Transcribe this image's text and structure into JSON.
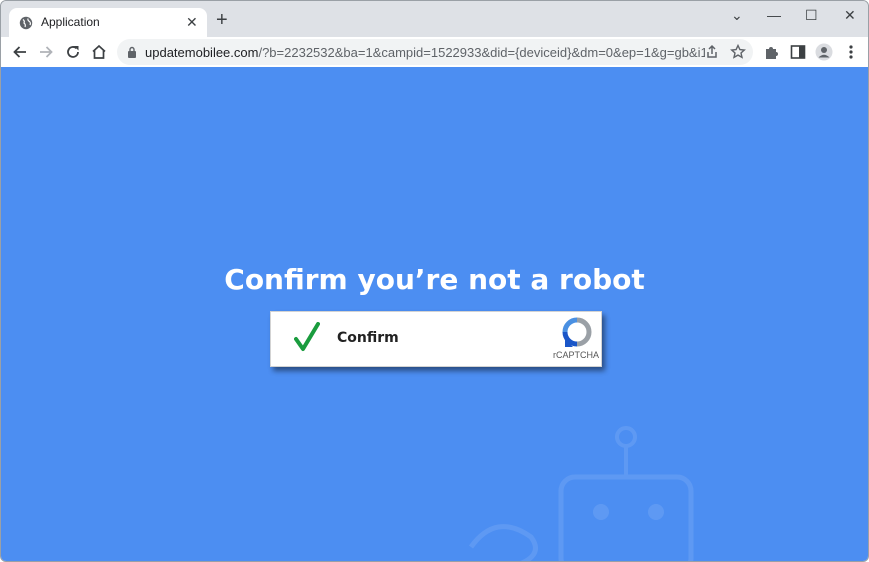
{
  "browser": {
    "tab_title": "Application",
    "tab_close": "✕",
    "new_tab": "+",
    "url_host": "updatemobilee.com",
    "url_rest": "/?b=2232532&ba=1&campid=1522933&did={deviceid}&dm=0&ep=1&g=gb&i18db..."
  },
  "window_controls": {
    "dropdown": "⌄",
    "minimize": "—",
    "maximize": "☐",
    "close": "✕"
  },
  "page": {
    "headline": "Confirm you’re not a robot",
    "confirm_label": "Confirm",
    "captcha_brand": "rCAPTCHA",
    "background_color": "#4c8ef2"
  },
  "icons": {
    "favicon": "globe-icon",
    "back": "back-arrow-icon",
    "forward": "forward-arrow-icon",
    "reload": "reload-icon",
    "home": "home-icon",
    "lock": "lock-icon",
    "share": "share-icon",
    "bookmark": "star-icon",
    "extensions": "puzzle-icon",
    "sidepanel": "side-panel-icon",
    "profile": "profile-icon",
    "menu": "kebab-menu-icon"
  }
}
